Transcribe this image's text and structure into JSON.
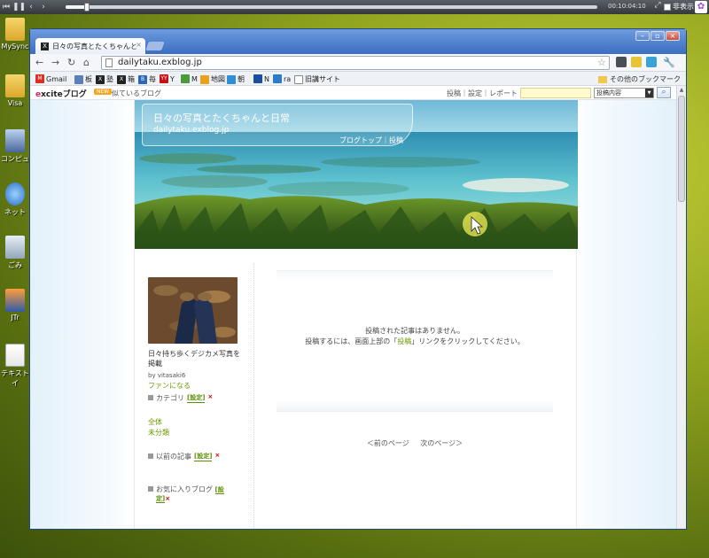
{
  "player": {
    "time": "00:10:04:10",
    "hide_label": "非表示",
    "progress": 0.04
  },
  "desktop": {
    "icons": [
      {
        "label": "MySync",
        "kind": "folder"
      },
      {
        "label": "Visa",
        "kind": "folder"
      },
      {
        "label": "コンピュ",
        "kind": "pc"
      },
      {
        "label": "ネット",
        "kind": "net"
      },
      {
        "label": "ごみ",
        "kind": "trash"
      },
      {
        "label": "JTr",
        "kind": "jtr"
      },
      {
        "label": "テキスト\nイ",
        "kind": "textfile"
      }
    ]
  },
  "browser": {
    "tab_title": "日々の写真とたくちゃんと",
    "tab_favicon": "X",
    "url": "dailytaku.exblog.jp",
    "bookmarks": [
      {
        "label": "Gmail",
        "icon": "M",
        "color": "#d93025"
      },
      {
        "label": "板",
        "icon": "",
        "color": "#5b7fb8"
      },
      {
        "label": "塾",
        "icon": "X",
        "color": "#222222"
      },
      {
        "label": "箱",
        "icon": "X",
        "color": "#222222"
      },
      {
        "label": "毎",
        "icon": "B",
        "color": "#2d66b5"
      },
      {
        "label": "Y",
        "icon": "YY",
        "color": "#c41212"
      },
      {
        "label": "M",
        "icon": "",
        "color": "#4b9b3a"
      },
      {
        "label": "地図",
        "icon": "",
        "color": "#e8a21a"
      },
      {
        "label": "朝",
        "icon": "",
        "color": "#2d8fd5"
      },
      {
        "label": "N",
        "icon": "",
        "color": "#1b4f9c"
      },
      {
        "label": "ra",
        "icon": "",
        "color": "#2a7cc7"
      },
      {
        "label": "旧講サイト",
        "icon": "",
        "color": "#ffffff"
      }
    ],
    "other_bookmarks": "その他のブックマーク"
  },
  "excite": {
    "logo_prefix": "e",
    "logo_rest": "xcite",
    "logo_blog": "ブログ",
    "new_badge": "NEW",
    "similar_blog": "似ているブログ",
    "links": "投稿｜設定｜レポート",
    "search_value": "",
    "search_select": "投稿内容"
  },
  "blog": {
    "title": "日々の写真とたくちゃんと日常",
    "url": "dailytaku.exblog.jp",
    "nav": "ブログトップ｜投稿",
    "profile": {
      "desc": "日々持ち歩くデジカメ写真を掲載",
      "by": "by vitasaki6",
      "fan": "ファンになる"
    },
    "sidebar": {
      "category_head": "カテゴリ",
      "set_label": "[設定]",
      "x_label": "×",
      "categories": [
        "全体",
        "未分類"
      ],
      "archive_head": "以前の記事",
      "fav_head": "お気に入りブログ"
    },
    "empty_line1": "投稿された記事はありません。",
    "empty_line2_pre": "投稿するには、画面上部の「",
    "empty_line2_link": "投稿",
    "empty_line2_post": "」リンクをクリックしてください。",
    "prev_page": "＜前のページ",
    "next_page": "次のページ＞"
  },
  "colors": {
    "accent_green": "#6a9a00",
    "window_blue": "#3f73c4"
  }
}
